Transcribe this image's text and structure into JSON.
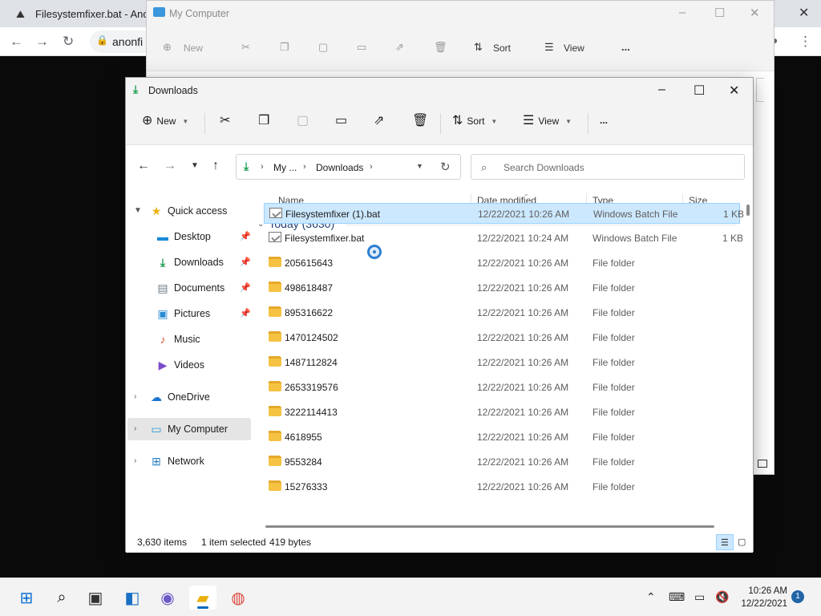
{
  "browser": {
    "tab_title": "Filesystemfixer.bat - Anon",
    "address_partial": "anonfi"
  },
  "bg_window": {
    "title": "My Computer",
    "toolbar": {
      "new_label": "New",
      "sort_label": "Sort",
      "view_label": "View",
      "more_label": "..."
    }
  },
  "window": {
    "title": "Downloads",
    "toolbar": {
      "new_label": "New",
      "sort_label": "Sort",
      "view_label": "View",
      "more_label": "..."
    },
    "address": {
      "crumbs": [
        "My ...",
        "Downloads"
      ]
    },
    "search": {
      "placeholder": "Search Downloads"
    },
    "sidebar": {
      "items": [
        {
          "label": "Quick access",
          "icon": "star-icon",
          "expanded": true,
          "pinned": false
        },
        {
          "label": "Desktop",
          "icon": "desktop-icon",
          "pinned": true
        },
        {
          "label": "Downloads",
          "icon": "download-icon",
          "pinned": true
        },
        {
          "label": "Documents",
          "icon": "documents-icon",
          "pinned": true
        },
        {
          "label": "Pictures",
          "icon": "pictures-icon",
          "pinned": true
        },
        {
          "label": "Music",
          "icon": "music-icon",
          "pinned": false
        },
        {
          "label": "Videos",
          "icon": "videos-icon",
          "pinned": false
        },
        {
          "label": "OneDrive",
          "icon": "cloud-icon",
          "pinned": false
        },
        {
          "label": "My Computer",
          "icon": "computer-icon",
          "pinned": false,
          "selected": true
        },
        {
          "label": "Network",
          "icon": "network-icon",
          "pinned": false
        }
      ]
    },
    "columns": [
      "Name",
      "Date modified",
      "Type",
      "Size"
    ],
    "group_label": "Today (3630)",
    "files": [
      {
        "name": "Filesystemfixer (1).bat",
        "date": "12/22/2021 10:26 AM",
        "type": "Windows Batch File",
        "size": "1 KB",
        "kind": "bat",
        "selected": true
      },
      {
        "name": "Filesystemfixer.bat",
        "date": "12/22/2021 10:24 AM",
        "type": "Windows Batch File",
        "size": "1 KB",
        "kind": "bat"
      },
      {
        "name": "205615643",
        "date": "12/22/2021 10:26 AM",
        "type": "File folder",
        "size": "",
        "kind": "folder"
      },
      {
        "name": "498618487",
        "date": "12/22/2021 10:26 AM",
        "type": "File folder",
        "size": "",
        "kind": "folder"
      },
      {
        "name": "895316622",
        "date": "12/22/2021 10:26 AM",
        "type": "File folder",
        "size": "",
        "kind": "folder"
      },
      {
        "name": "1470124502",
        "date": "12/22/2021 10:26 AM",
        "type": "File folder",
        "size": "",
        "kind": "folder"
      },
      {
        "name": "1487112824",
        "date": "12/22/2021 10:26 AM",
        "type": "File folder",
        "size": "",
        "kind": "folder"
      },
      {
        "name": "2653319576",
        "date": "12/22/2021 10:26 AM",
        "type": "File folder",
        "size": "",
        "kind": "folder"
      },
      {
        "name": "3222114413",
        "date": "12/22/2021 10:26 AM",
        "type": "File folder",
        "size": "",
        "kind": "folder"
      },
      {
        "name": "4618955",
        "date": "12/22/2021 10:26 AM",
        "type": "File folder",
        "size": "",
        "kind": "folder"
      },
      {
        "name": "9553284",
        "date": "12/22/2021 10:26 AM",
        "type": "File folder",
        "size": "",
        "kind": "folder"
      },
      {
        "name": "15276333",
        "date": "12/22/2021 10:26 AM",
        "type": "File folder",
        "size": "",
        "kind": "folder"
      }
    ],
    "status": {
      "count": "3,630 items",
      "selection": "1 item selected",
      "size": "419 bytes"
    }
  },
  "taskbar": {
    "time": "10:26 AM",
    "date": "12/22/2021",
    "notification_count": "1"
  },
  "colors": {
    "selection_bg": "#cce8ff",
    "selection_border": "#99d1ff",
    "accent": "#0067c0",
    "folder": "#f5c242"
  }
}
